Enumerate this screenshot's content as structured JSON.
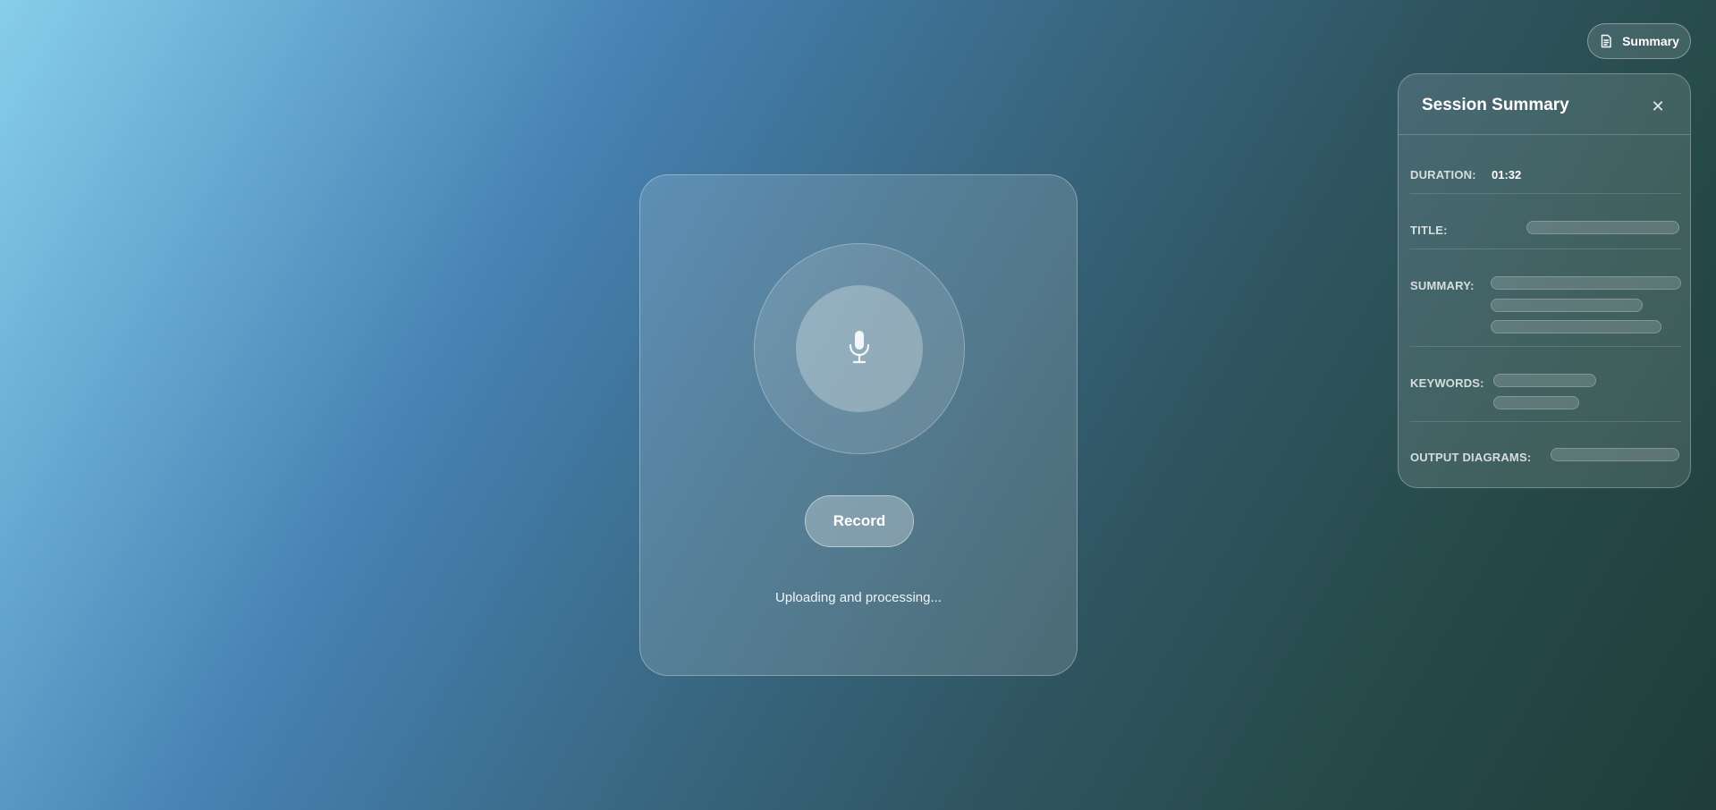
{
  "header": {
    "summary_button_label": "Summary",
    "summary_button_icon": "document-icon"
  },
  "summary_panel": {
    "title": "Session Summary",
    "close_icon": "close-icon",
    "close_glyph": "✕",
    "fields": {
      "duration": {
        "label": "DURATION:",
        "value": "01:32"
      },
      "title": {
        "label": "TITLE:"
      },
      "summary": {
        "label": "SUMMARY:"
      },
      "keywords": {
        "label": "KEYWORDS:"
      },
      "output_diagrams": {
        "label": "OUTPUT DIAGRAMS:"
      }
    }
  },
  "recorder": {
    "mic_icon": "microphone-icon",
    "record_label": "Record",
    "status": "Uploading and processing..."
  }
}
